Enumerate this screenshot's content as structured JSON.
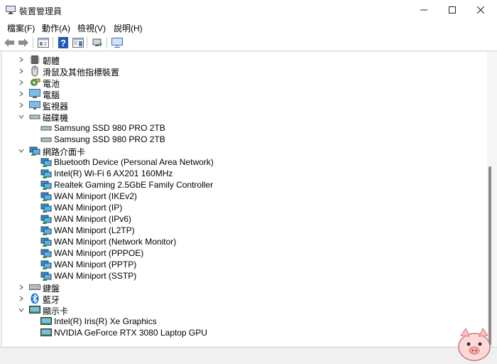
{
  "window": {
    "title": "裝置管理員"
  },
  "menu": {
    "items": [
      "檔案(F)",
      "動作(A)",
      "檢視(V)",
      "說明(H)"
    ]
  },
  "toolbar": {
    "icons": [
      "back-arrow-icon",
      "forward-arrow-icon",
      "properties-icon",
      "help-icon",
      "show-hidden-icon",
      "update-driver-icon",
      "monitor-icon"
    ]
  },
  "tree": {
    "firmware": "韌體",
    "mice": "滑鼠及其他指標裝置",
    "batteries": "電池",
    "computer": "電腦",
    "monitors": "監視器",
    "disks": {
      "label": "磁碟機",
      "children": [
        "Samsung SSD 980 PRO 2TB",
        "Samsung SSD 980 PRO 2TB"
      ]
    },
    "network": {
      "label": "網路介面卡",
      "children": [
        "Bluetooth Device (Personal Area Network)",
        "Intel(R) Wi-Fi 6 AX201 160MHz",
        "Realtek Gaming 2.5GbE Family Controller",
        "WAN Miniport (IKEv2)",
        "WAN Miniport (IP)",
        "WAN Miniport (IPv6)",
        "WAN Miniport (L2TP)",
        "WAN Miniport (Network Monitor)",
        "WAN Miniport (PPPOE)",
        "WAN Miniport (PPTP)",
        "WAN Miniport (SSTP)"
      ]
    },
    "keyboards": "鍵盤",
    "bluetooth": "藍牙",
    "display": {
      "label": "顯示卡",
      "children": [
        "Intel(R) Iris(R) Xe Graphics",
        "NVIDIA GeForce RTX 3080 Laptop GPU"
      ]
    }
  }
}
